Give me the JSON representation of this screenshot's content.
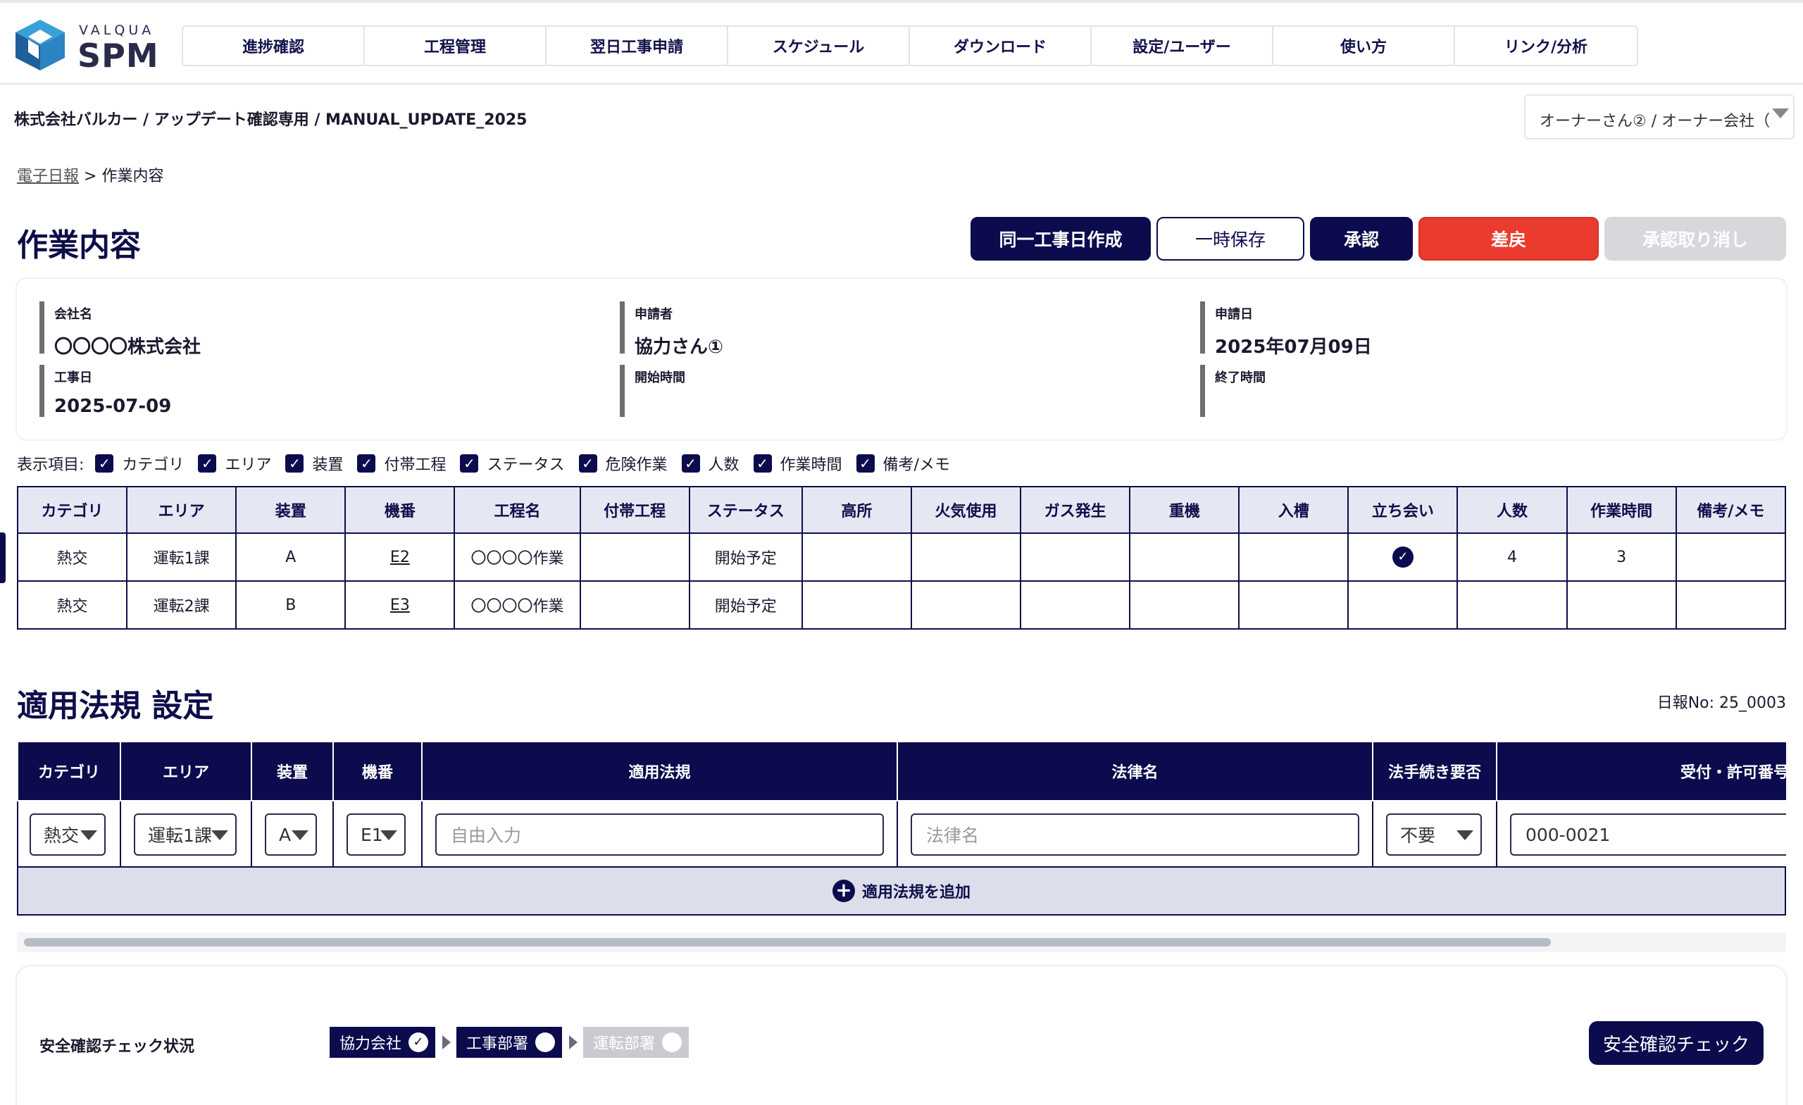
{
  "logo": {
    "small": "VALQUA",
    "big": "SPM"
  },
  "nav": [
    "進捗確認",
    "工程管理",
    "翌日工事申請",
    "スケジュール",
    "ダウンロード",
    "設定/ユーザー",
    "使い方",
    "リンク/分析"
  ],
  "company_path": "株式会社バルカー / アップデート確認専用 / MANUAL_UPDATE_2025",
  "owner_select": "オーナーさん② / オーナー会社（",
  "breadcrumb": {
    "link": "電子日報",
    "sep": " > ",
    "current": "作業内容"
  },
  "page_title": "作業内容",
  "buttons": {
    "same_day": "同一工事日作成",
    "temp_save": "一時保存",
    "approve": "承認",
    "return": "差戻",
    "cancel_approve": "承認取り消し"
  },
  "info": {
    "company_label": "会社名",
    "company_value": "〇〇〇〇株式会社",
    "applicant_label": "申請者",
    "applicant_value": "協力さん①",
    "apply_date_label": "申請日",
    "apply_date_value": "2025年07月09日",
    "work_date_label": "工事日",
    "work_date_value": "2025-07-09",
    "start_label": "開始時間",
    "end_label": "終了時間"
  },
  "display_items": {
    "label": "表示項目:",
    "items": [
      "カテゴリ",
      "エリア",
      "装置",
      "付帯工程",
      "ステータス",
      "危険作業",
      "人数",
      "作業時間",
      "備考/メモ"
    ]
  },
  "work_table": {
    "headers": [
      "カテゴリ",
      "エリア",
      "装置",
      "機番",
      "工程名",
      "付帯工程",
      "ステータス",
      "高所",
      "火気使用",
      "ガス発生",
      "重機",
      "入槽",
      "立ち会い",
      "人数",
      "作業時間",
      "備考/メモ"
    ],
    "rows": [
      {
        "category": "熱交",
        "area": "運転1課",
        "device": "A",
        "machine": "E2",
        "process": "〇〇〇〇作業",
        "status": "開始予定",
        "people": "4",
        "hours": "3",
        "witness": true
      },
      {
        "category": "熱交",
        "area": "運転2課",
        "device": "B",
        "machine": "E3",
        "process": "〇〇〇〇作業",
        "status": "開始予定",
        "people": "",
        "hours": "",
        "witness": false
      }
    ]
  },
  "law": {
    "title": "適用法規 設定",
    "nippo_no": "日報No: 25_0003",
    "headers": [
      "カテゴリ",
      "エリア",
      "装置",
      "機番",
      "適用法規",
      "法律名",
      "法手続き要否",
      "受付・許可番号"
    ],
    "row": {
      "category": "熱交",
      "area": "運転1課",
      "device": "A",
      "machine": "E1",
      "law_placeholder": "自由入力",
      "law_name_placeholder": "法律名",
      "procedure": "不要",
      "permit_no": "000-0021"
    },
    "add_label": "適用法規を追加"
  },
  "safety": {
    "label": "安全確認チェック状況",
    "steps": [
      "協力会社",
      "工事部署",
      "運転部署"
    ],
    "button": "安全確認チェック"
  },
  "colors": {
    "navy": "#0b0b4d",
    "red": "#ea3b2e",
    "disabled": "#d6d8dc",
    "header_bg": "#e5e7f2"
  }
}
